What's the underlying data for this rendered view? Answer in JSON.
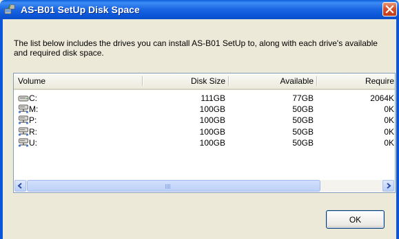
{
  "window": {
    "title": "AS-B01 SetUp Disk Space"
  },
  "description": "The list below includes the drives you can install AS-B01 SetUp to, along with each drive's available and required disk space.",
  "columns": {
    "volume": "Volume",
    "disk_size": "Disk Size",
    "available": "Available",
    "required": "Require"
  },
  "drives": [
    {
      "volume": "C:",
      "icon": "local-disk-icon",
      "disk_size": "111GB",
      "available": "77GB",
      "required": "2064K"
    },
    {
      "volume": "M:",
      "icon": "network-drive-icon",
      "disk_size": "100GB",
      "available": "50GB",
      "required": "0K"
    },
    {
      "volume": "P:",
      "icon": "network-drive-icon",
      "disk_size": "100GB",
      "available": "50GB",
      "required": "0K"
    },
    {
      "volume": "R:",
      "icon": "network-drive-icon",
      "disk_size": "100GB",
      "available": "50GB",
      "required": "0K"
    },
    {
      "volume": "U:",
      "icon": "network-drive-icon",
      "disk_size": "100GB",
      "available": "50GB",
      "required": "0K"
    }
  ],
  "buttons": {
    "ok": "OK"
  },
  "colors": {
    "titlebar": "#0b56d9",
    "close": "#d4502b",
    "dialog_bg": "#ece9d8"
  }
}
